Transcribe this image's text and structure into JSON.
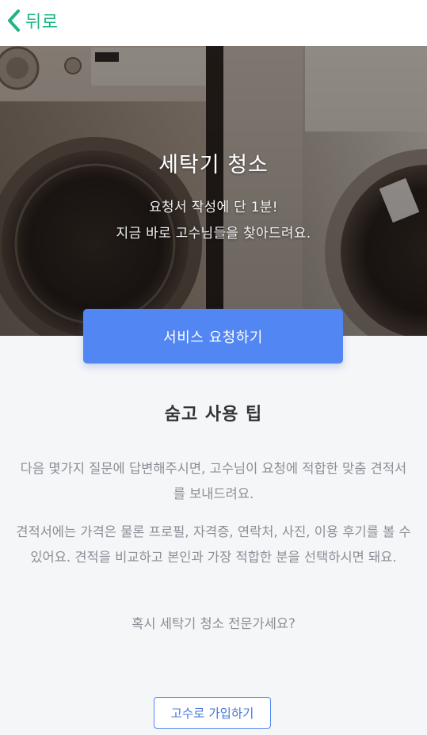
{
  "topbar": {
    "back_label": "뒤로"
  },
  "hero": {
    "title": "세탁기 청소",
    "subtitle_line1": "요청서 작성에 단 1분!",
    "subtitle_line2": "지금 바로 고수님들을 찾아드려요."
  },
  "request_button_label": "서비스 요청하기",
  "tips": {
    "title": "숨고 사용 팁",
    "paragraph1": "다음 몇가지 질문에 답변해주시면, 고수님이 요청에 적합한 맞춤 견적서를 보내드려요.",
    "paragraph2": "견적서에는 가격은 물론 프로필, 자격증, 연락처, 사진, 이용 후기를 볼 수 있어요. 견적을 비교하고 본인과 가장 적합한 분을 선택하시면 돼요.",
    "question": "혹시 세탁기 청소 전문가세요?"
  },
  "signup_button_label": "고수로 가입하기",
  "colors": {
    "accent_green": "#1fb67f",
    "primary_blue": "#5286f2",
    "background": "#f5f6f8"
  }
}
